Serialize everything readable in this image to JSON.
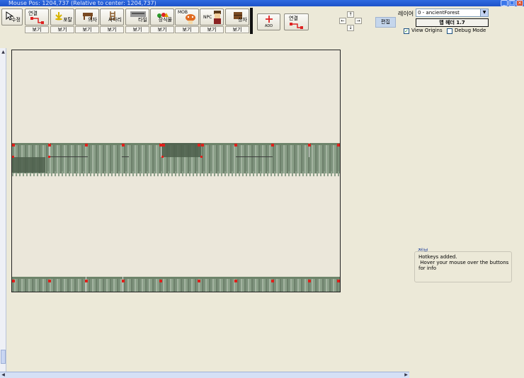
{
  "window": {
    "title": "Mouse Pos: 1204,737 (Relative to center: 1204,737)",
    "controls": [
      "_",
      "□",
      "×"
    ]
  },
  "toolbar": {
    "edit_label": "수정",
    "tools": [
      {
        "label": "연결",
        "icon": "connect-icon"
      },
      {
        "label": "포탈",
        "icon": "portal-icon"
      },
      {
        "label": "의자",
        "icon": "chair-icon"
      },
      {
        "label": "사다리",
        "icon": "ladder-icon"
      },
      {
        "label": "타일",
        "icon": "tile-icon"
      },
      {
        "label": "장식물",
        "icon": "decoration-icon"
      },
      {
        "label": "MOB",
        "icon": "mob-icon"
      },
      {
        "label": "NPC",
        "icon": "npc-icon"
      },
      {
        "label": "상자",
        "icon": "box-icon"
      }
    ],
    "view_label": "보기",
    "add_label": "ADD",
    "connect2_label": "연결"
  },
  "nav": {
    "up": "↑",
    "down": "↓",
    "left": "←",
    "right": "→",
    "edit_label": "편집"
  },
  "right_panel": {
    "layer_label": "레이어",
    "layer_value": "0 - ancientForest",
    "header_button": "맵 헤더 1.7",
    "view_origins_label": "View Origins",
    "view_origins_checked": true,
    "debug_mode_label": "Debug Mode",
    "debug_mode_checked": false
  },
  "info": {
    "label": "정보",
    "lines": [
      "Hotkeys added.",
      " Hover your mouse over the buttons",
      "for info"
    ]
  },
  "colors": {
    "title_bar": "#1d52c9",
    "background": "#ece9d8",
    "marker": "#e0201b"
  }
}
